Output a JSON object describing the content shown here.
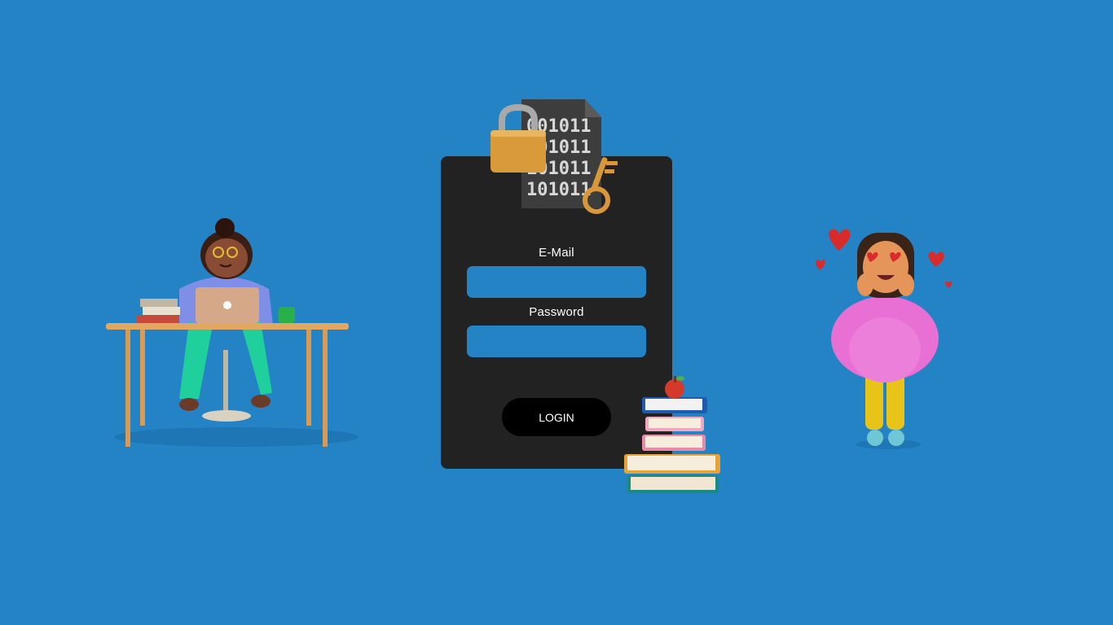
{
  "login": {
    "email_label": "E-Mail",
    "email_value": "",
    "password_label": "Password",
    "password_value": "",
    "login_button": "LOGIN"
  },
  "security_graphic": {
    "binary_lines": [
      "001011",
      "101011",
      "101011",
      "101011"
    ]
  },
  "colors": {
    "background": "#2383c5",
    "card": "#222222",
    "input": "#2383c5",
    "button": "#000000"
  },
  "icons": [
    "padlock-icon",
    "key-icon",
    "binary-file-icon",
    "book-stack-icon",
    "apple-icon",
    "heart-icon"
  ]
}
